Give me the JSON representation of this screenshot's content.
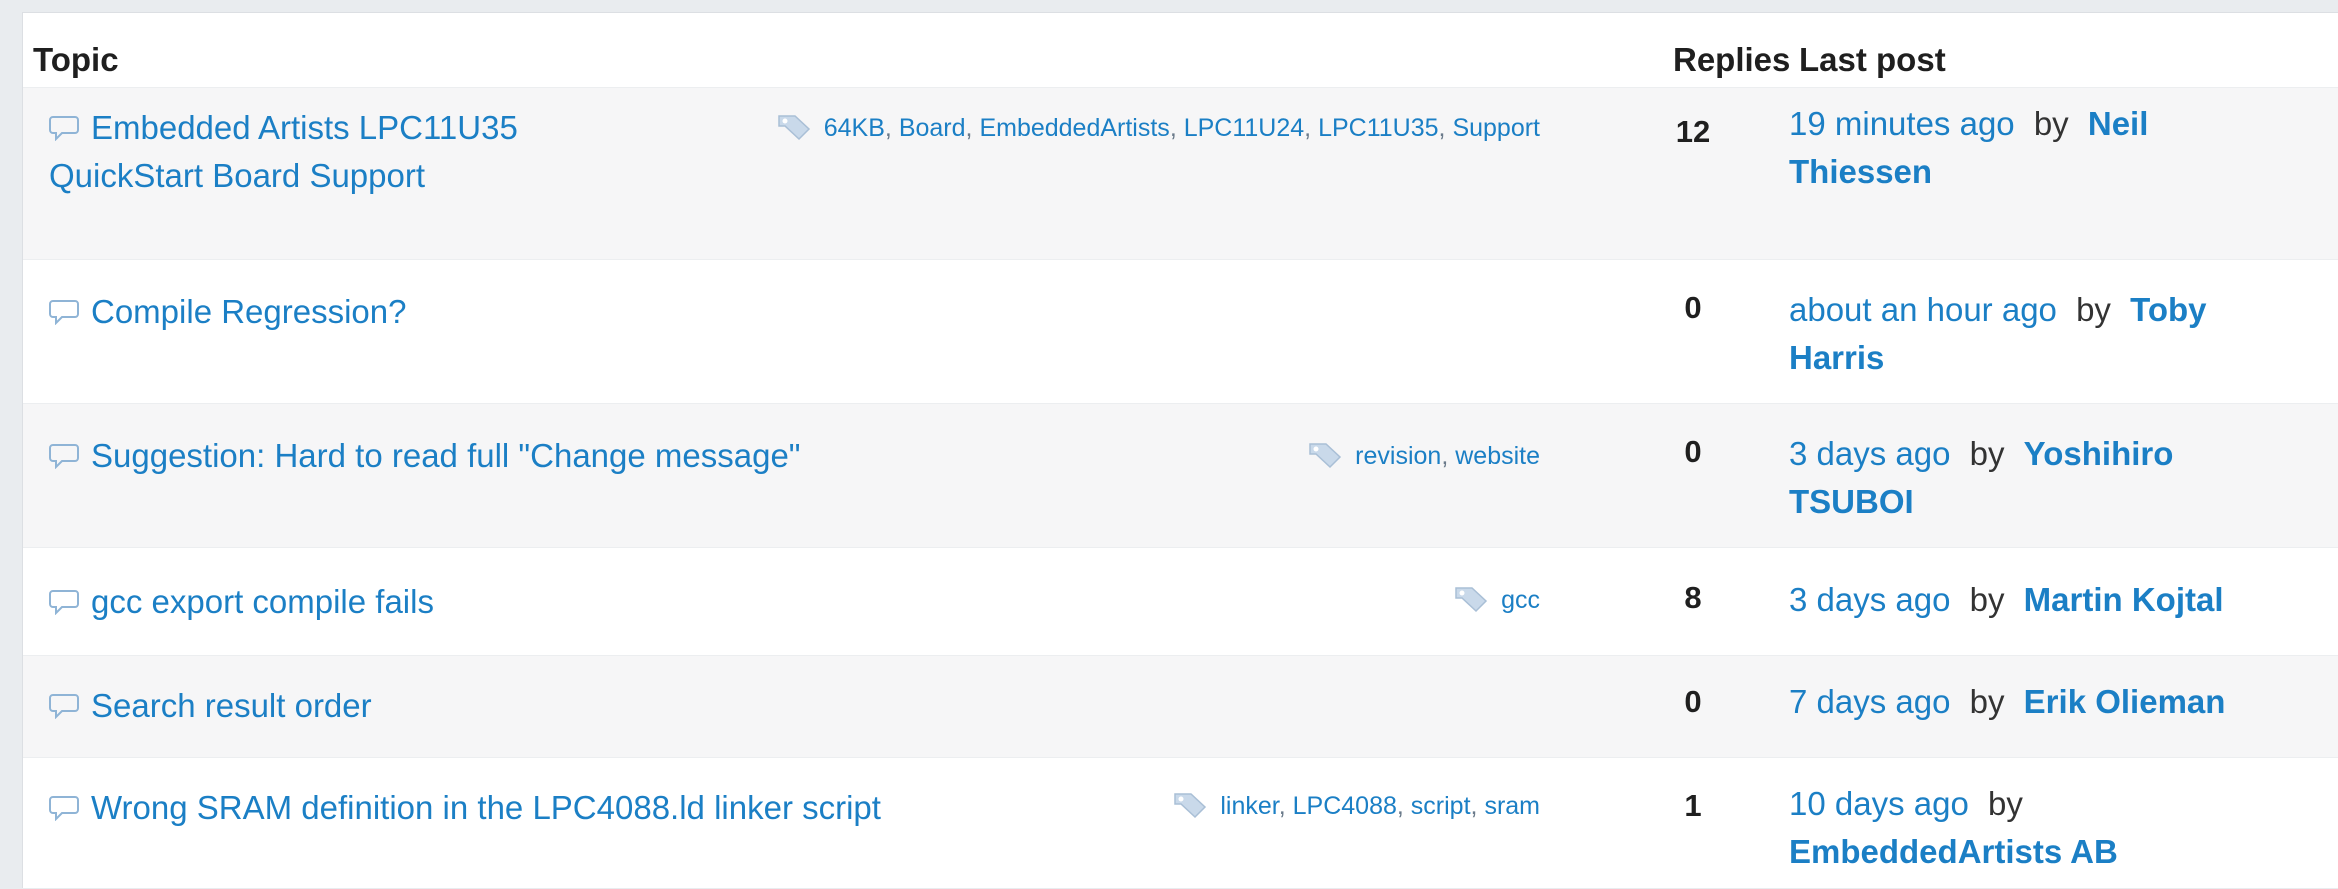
{
  "headers": {
    "topic": "Topic",
    "replies": "Replies",
    "last_post": "Last post"
  },
  "by_word": "by",
  "colors": {
    "link": "#1b7fc5",
    "row_alt": "#f6f6f7",
    "text": "#1f1f1f"
  },
  "rows": [
    {
      "title_line1": "Embedded Artists LPC11U35",
      "title_line2": "QuickStart Board Support",
      "tags": [
        "64KB",
        "Board",
        "EmbeddedArtists",
        "LPC11U24",
        "LPC11U35",
        "Support"
      ],
      "replies": "12",
      "when": "19 minutes ago",
      "user_line1": "Neil",
      "user_line2": "Thiessen"
    },
    {
      "title_line1": "Compile Regression?",
      "tags": [],
      "replies": "0",
      "when": "about an hour ago",
      "user_line1": "Toby",
      "user_line2": "Harris"
    },
    {
      "title_line1": "Suggestion: Hard to read full \"Change message\"",
      "tags": [
        "revision",
        "website"
      ],
      "replies": "0",
      "when": "3 days ago",
      "user_line1": "Yoshihiro",
      "user_line2": "TSUBOI"
    },
    {
      "title_line1": "gcc export compile fails",
      "tags": [
        "gcc"
      ],
      "replies": "8",
      "when": "3 days ago",
      "user_line1": "Martin Kojtal"
    },
    {
      "title_line1": "Search result order",
      "tags": [],
      "replies": "0",
      "when": "7 days ago",
      "user_line1": "Erik Olieman"
    },
    {
      "title_line1": "Wrong SRAM definition in the LPC4088.ld linker script",
      "tags": [
        "linker",
        "LPC4088",
        "script",
        "sram"
      ],
      "replies": "1",
      "when": "10 days ago",
      "user_line1": "",
      "user_line2": "EmbeddedArtists AB"
    }
  ]
}
